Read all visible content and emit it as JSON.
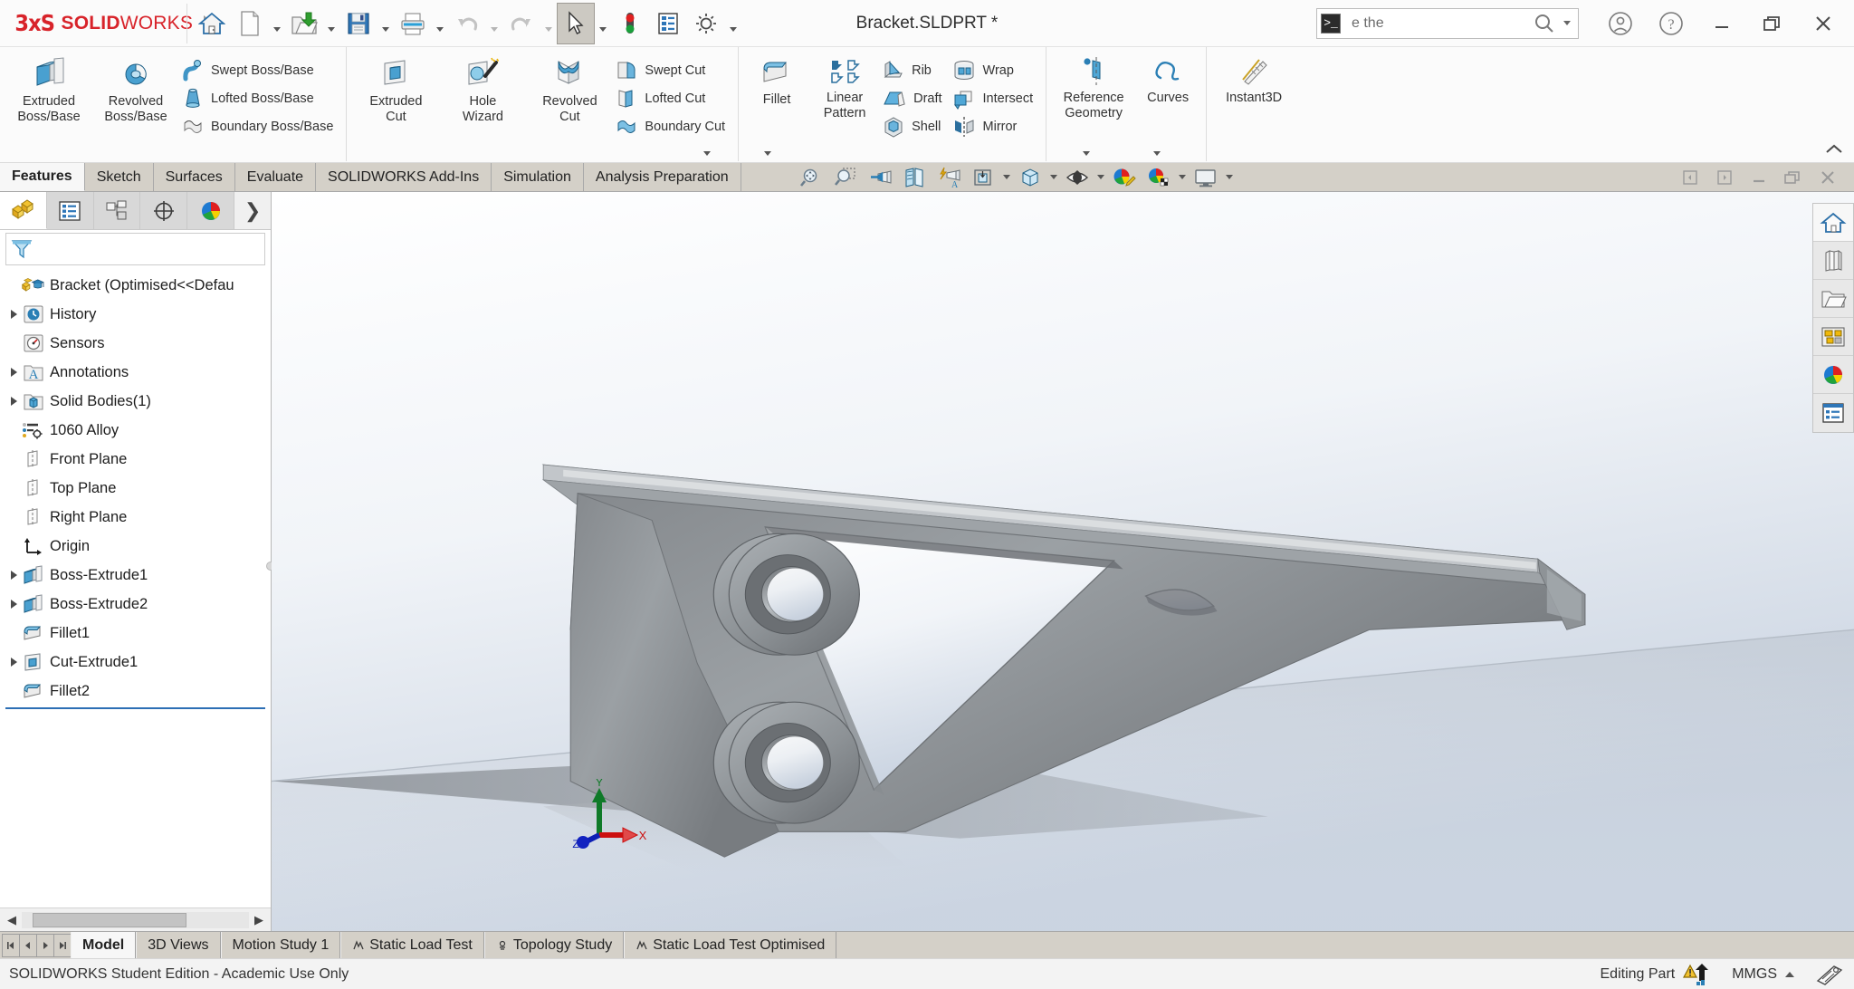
{
  "titlebar": {
    "brand_mark": "3DS",
    "brand_solid": "SOLID",
    "brand_works": "WORKS",
    "document_title": "Bracket.SLDPRT *",
    "quick_access": [
      {
        "name": "home-icon",
        "tip": "Home"
      },
      {
        "name": "new-document-icon",
        "tip": "New"
      },
      {
        "name": "open-folder-icon",
        "tip": "Open"
      },
      {
        "name": "save-icon",
        "tip": "Save"
      },
      {
        "name": "print-icon",
        "tip": "Print"
      },
      {
        "name": "undo-icon",
        "tip": "Undo"
      },
      {
        "name": "redo-icon",
        "tip": "Redo"
      },
      {
        "name": "select-cursor-icon",
        "tip": "Select"
      },
      {
        "name": "rebuild-traffic-light-icon",
        "tip": "Rebuild"
      },
      {
        "name": "file-properties-icon",
        "tip": "File Properties"
      },
      {
        "name": "options-gear-icon",
        "tip": "Options"
      }
    ],
    "search": {
      "value": "e the",
      "prompt_icon": ">_",
      "search_icon": "search-icon"
    },
    "account_icon": "user-account-icon",
    "help_icon": "help-question-icon",
    "window_controls": [
      "minimize",
      "restore",
      "close"
    ]
  },
  "ribbon": {
    "groups": [
      {
        "name": "features-primary",
        "big": [
          {
            "label": "Extruded\nBoss/Base",
            "icon": "extruded-boss-icon"
          },
          {
            "label": "Revolved\nBoss/Base",
            "icon": "revolved-boss-icon"
          }
        ],
        "small": [
          {
            "label": "Swept Boss/Base",
            "icon": "swept-boss-icon"
          },
          {
            "label": "Lofted Boss/Base",
            "icon": "lofted-boss-icon"
          },
          {
            "label": "Boundary Boss/Base",
            "icon": "boundary-boss-icon"
          }
        ]
      },
      {
        "name": "cut-features",
        "big": [
          {
            "label": "Extruded\nCut",
            "icon": "extruded-cut-icon"
          },
          {
            "label": "Hole\nWizard",
            "icon": "hole-wizard-icon"
          },
          {
            "label": "Revolved\nCut",
            "icon": "revolved-cut-icon"
          }
        ],
        "small": [
          {
            "label": "Swept Cut",
            "icon": "swept-cut-icon"
          },
          {
            "label": "Lofted Cut",
            "icon": "lofted-cut-icon"
          },
          {
            "label": "Boundary Cut",
            "icon": "boundary-cut-icon"
          }
        ]
      },
      {
        "name": "modify-features",
        "big": [
          {
            "label": "Fillet",
            "icon": "fillet-icon"
          },
          {
            "label": "Linear\nPattern",
            "icon": "linear-pattern-icon"
          }
        ],
        "small": [
          {
            "label": "Rib",
            "icon": "rib-icon"
          },
          {
            "label": "Draft",
            "icon": "draft-icon"
          },
          {
            "label": "Shell",
            "icon": "shell-icon"
          }
        ],
        "small2": [
          {
            "label": "Wrap",
            "icon": "wrap-icon"
          },
          {
            "label": "Intersect",
            "icon": "intersect-icon"
          },
          {
            "label": "Mirror",
            "icon": "mirror-icon"
          }
        ]
      },
      {
        "name": "reference-group",
        "big": [
          {
            "label": "Reference\nGeometry",
            "icon": "reference-geometry-icon"
          },
          {
            "label": "Curves",
            "icon": "curves-icon"
          }
        ]
      },
      {
        "name": "instant3d-group",
        "big": [
          {
            "label": "Instant3D",
            "icon": "instant3d-icon"
          }
        ]
      }
    ]
  },
  "command_tabs": {
    "items": [
      {
        "label": "Features",
        "active": true
      },
      {
        "label": "Sketch",
        "active": false
      },
      {
        "label": "Surfaces",
        "active": false
      },
      {
        "label": "Evaluate",
        "active": false
      },
      {
        "label": "SOLIDWORKS Add-Ins",
        "active": false
      },
      {
        "label": "Simulation",
        "active": false
      },
      {
        "label": "Analysis Preparation",
        "active": false
      }
    ],
    "view_tools": [
      {
        "name": "zoom-to-fit-icon"
      },
      {
        "name": "zoom-to-area-icon"
      },
      {
        "name": "previous-view-icon"
      },
      {
        "name": "section-view-icon"
      },
      {
        "name": "view-orientation-lightning-icon"
      },
      {
        "name": "view-orientation-cube-icon",
        "caret": true
      },
      {
        "name": "display-style-icon",
        "caret": true
      },
      {
        "name": "hide-show-items-icon",
        "caret": true
      },
      {
        "name": "edit-appearance-icon"
      },
      {
        "name": "apply-scene-icon",
        "caret": true
      },
      {
        "name": "view-settings-icon",
        "caret": true
      }
    ],
    "right_controls": [
      {
        "name": "panel-left-icon"
      },
      {
        "name": "panel-right-icon"
      },
      {
        "name": "minimize-doc-icon"
      },
      {
        "name": "restore-doc-icon"
      },
      {
        "name": "close-doc-icon"
      }
    ]
  },
  "feature_tree": {
    "panel_tabs": [
      {
        "name": "feature-manager-tab",
        "icon": "feature-tree-icon",
        "active": true
      },
      {
        "name": "property-manager-tab",
        "icon": "property-manager-icon",
        "active": false
      },
      {
        "name": "configuration-manager-tab",
        "icon": "configuration-icon",
        "active": false
      },
      {
        "name": "dimxpert-manager-tab",
        "icon": "dimxpert-icon",
        "active": false
      },
      {
        "name": "display-manager-tab",
        "icon": "display-manager-icon",
        "active": false
      }
    ],
    "filter_placeholder": "",
    "nodes": [
      {
        "label": "Bracket  (Optimised<<Defau",
        "icon": "part-graduate-icon",
        "indent": 0,
        "expandable": false,
        "depth": 0
      },
      {
        "label": "History",
        "icon": "history-icon",
        "indent": 1,
        "expandable": true,
        "depth": 1
      },
      {
        "label": "Sensors",
        "icon": "sensors-icon",
        "indent": 1,
        "expandable": false,
        "depth": 1
      },
      {
        "label": "Annotations",
        "icon": "annotations-icon",
        "indent": 1,
        "expandable": true,
        "depth": 1
      },
      {
        "label": "Solid Bodies(1)",
        "icon": "solid-bodies-icon",
        "indent": 1,
        "expandable": true,
        "depth": 1
      },
      {
        "label": "1060 Alloy",
        "icon": "material-icon",
        "indent": 1,
        "expandable": false,
        "depth": 1
      },
      {
        "label": "Front Plane",
        "icon": "plane-icon",
        "indent": 1,
        "expandable": false,
        "depth": 1
      },
      {
        "label": "Top Plane",
        "icon": "plane-icon",
        "indent": 1,
        "expandable": false,
        "depth": 1
      },
      {
        "label": "Right Plane",
        "icon": "plane-icon",
        "indent": 1,
        "expandable": false,
        "depth": 1
      },
      {
        "label": "Origin",
        "icon": "origin-icon",
        "indent": 1,
        "expandable": false,
        "depth": 1
      },
      {
        "label": "Boss-Extrude1",
        "icon": "extruded-boss-icon",
        "indent": 1,
        "expandable": true,
        "depth": 1
      },
      {
        "label": "Boss-Extrude2",
        "icon": "extruded-boss-icon",
        "indent": 1,
        "expandable": true,
        "depth": 1
      },
      {
        "label": "Fillet1",
        "icon": "fillet-icon",
        "indent": 1,
        "expandable": false,
        "depth": 1
      },
      {
        "label": "Cut-Extrude1",
        "icon": "extruded-cut-icon",
        "indent": 1,
        "expandable": true,
        "depth": 1
      },
      {
        "label": "Fillet2",
        "icon": "fillet-icon",
        "indent": 1,
        "expandable": false,
        "depth": 1
      }
    ]
  },
  "viewport": {
    "model_name": "Bracket",
    "right_toolbar": [
      {
        "name": "view-home-icon",
        "active": true
      },
      {
        "name": "view-library-icon",
        "active": false
      },
      {
        "name": "open-folder-icon",
        "active": false
      },
      {
        "name": "appearances-icon",
        "active": false
      },
      {
        "name": "scenes-sphere-icon",
        "active": false
      },
      {
        "name": "custom-properties-icon",
        "active": false
      }
    ],
    "triad": {
      "x_label": "X",
      "y_label": "Y",
      "z_label": "Z",
      "x_color": "#cc0000",
      "y_color": "#007d21",
      "z_color": "#0b28c8"
    }
  },
  "bottom_tabs": {
    "nav_buttons": [
      "first",
      "previous",
      "next",
      "last"
    ],
    "items": [
      {
        "label": "Model",
        "active": true,
        "icon": ""
      },
      {
        "label": "3D Views",
        "active": false,
        "icon": ""
      },
      {
        "label": "Motion Study 1",
        "active": false,
        "icon": ""
      },
      {
        "label": "Static Load Test",
        "active": false,
        "icon": "study-icon"
      },
      {
        "label": "Topology Study",
        "active": false,
        "icon": "topology-icon"
      },
      {
        "label": "Static Load Test Optimised",
        "active": false,
        "icon": "study-icon"
      }
    ]
  },
  "statusbar": {
    "left_text": "SOLIDWORKS Student Edition - Academic Use Only",
    "editing_state": "Editing Part",
    "warning_icon": "warning-rebuild-icon",
    "units": "MMGS",
    "units_caret": "up-caret-icon",
    "overlay_icon": "display-overlay-icon"
  },
  "colors": {
    "brand_red": "#d8232a",
    "ribbon_bg": "#fbfbfb",
    "tab_bg": "#d4d0c8",
    "selection_blue": "#2d6fb5",
    "model_grey": "#7a7f84"
  }
}
